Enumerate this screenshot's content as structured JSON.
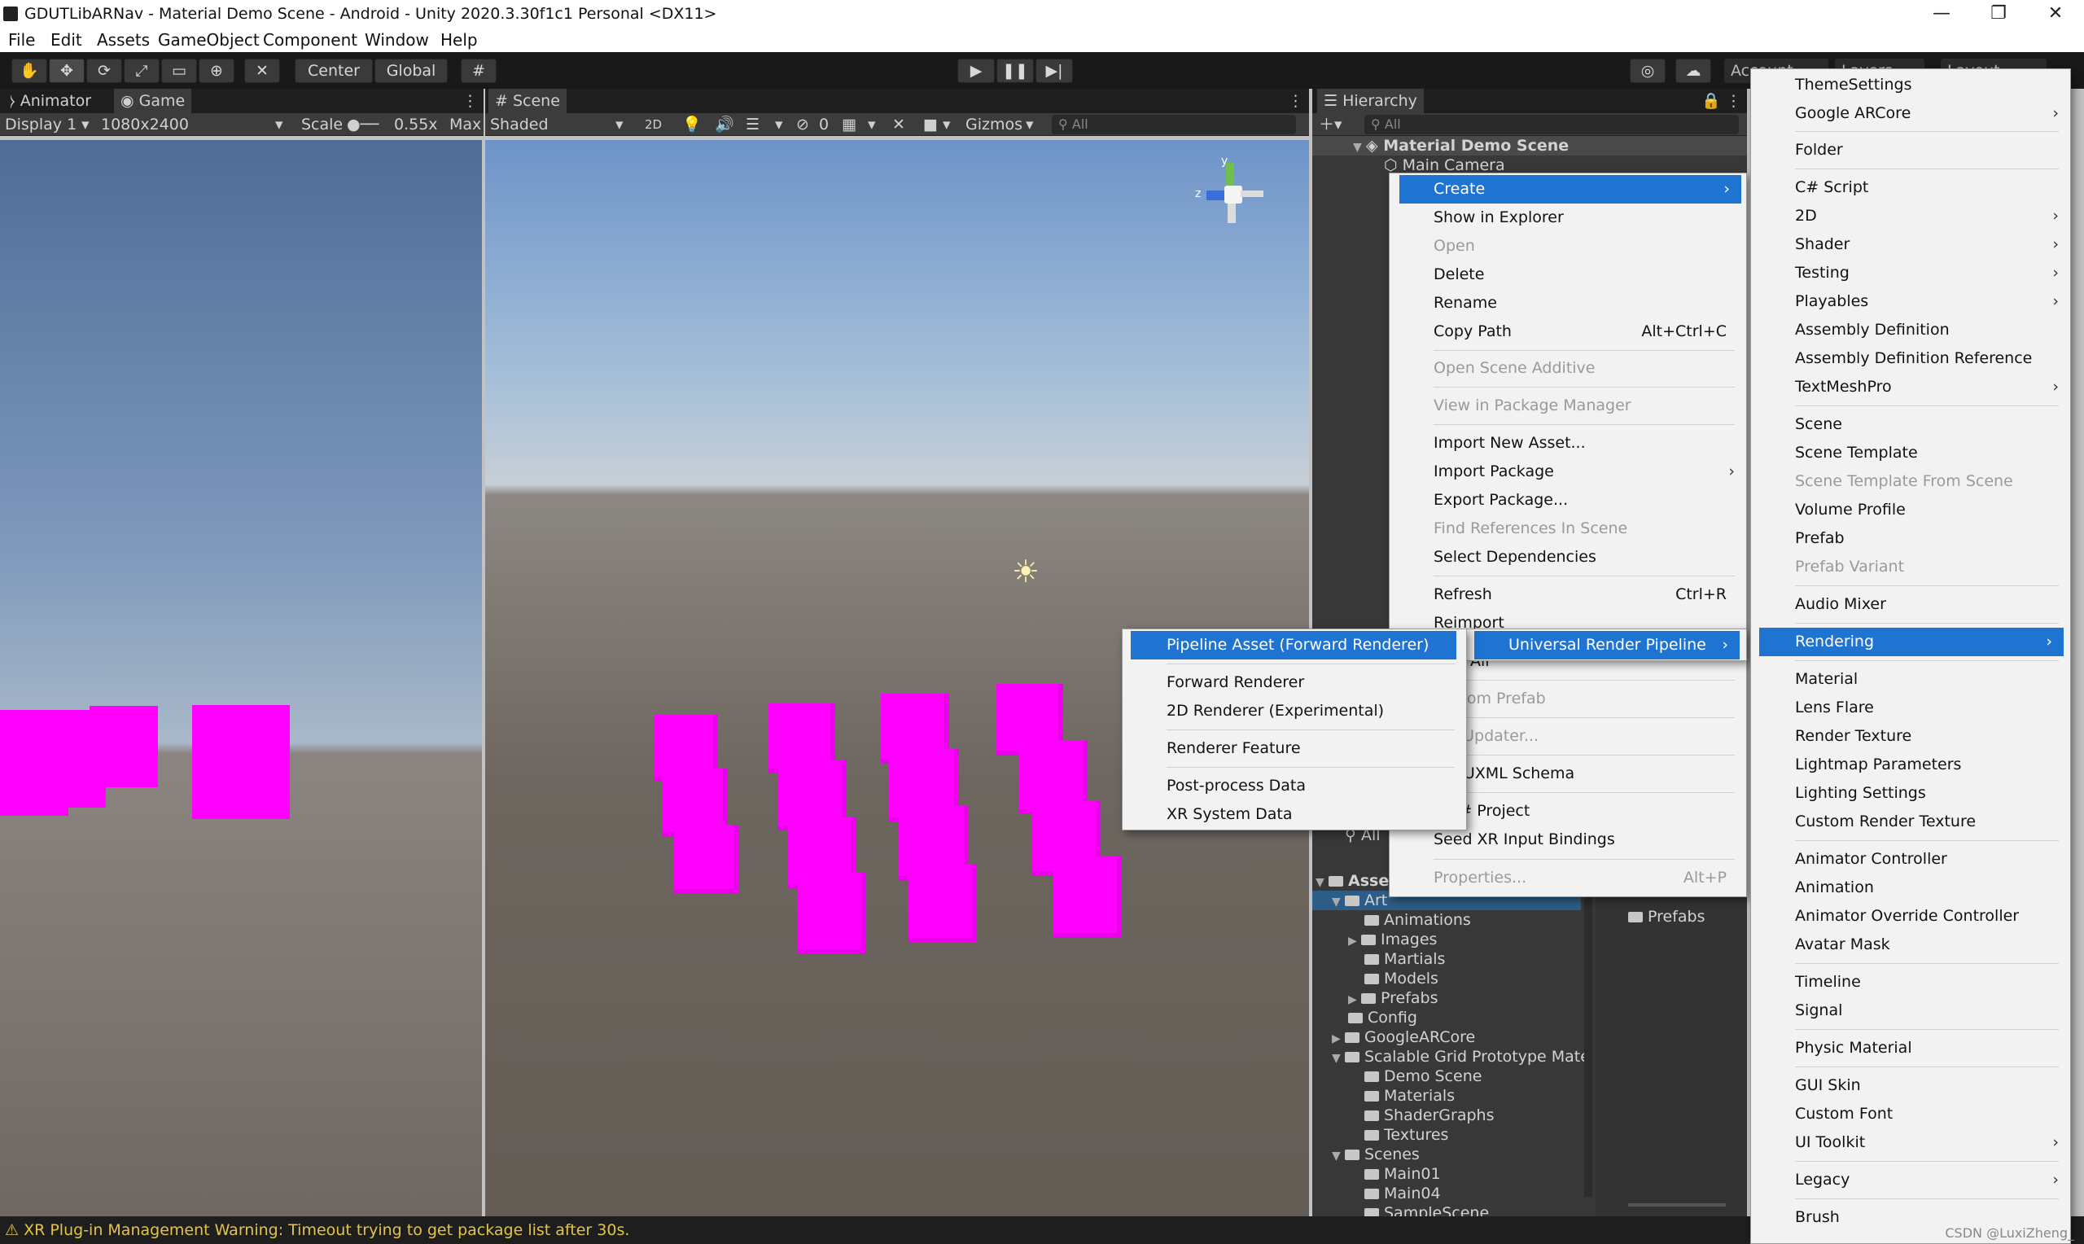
{
  "window": {
    "title": "GDUTLibARNav - Material Demo Scene - Android - Unity 2020.3.30f1c1 Personal <DX11>",
    "controls": [
      "—",
      "❐",
      "✕"
    ]
  },
  "menubar": [
    "File",
    "Edit",
    "Assets",
    "GameObject",
    "Component",
    "Window",
    "Help"
  ],
  "toolbar": {
    "pivot_label": "Center",
    "space_label": "Global",
    "account_label": "Account",
    "layers_label": "Layers",
    "layout_label": "Layout"
  },
  "game_panel": {
    "tabs": [
      "Animator",
      "Game"
    ],
    "display": "Display 1",
    "resolution": "1080x2400",
    "scale_label": "Scale",
    "scale_value": "0.55x",
    "max_label": "Max"
  },
  "scene_panel": {
    "tab": "Scene",
    "shading": "Shaded",
    "mode_2d": "2D",
    "hidden_count": "0",
    "gizmos": "Gizmos",
    "search_placeholder": "All",
    "axis_labels": {
      "y": "y",
      "z": "z"
    }
  },
  "hierarchy": {
    "tab": "Hierarchy",
    "search_placeholder": "All",
    "scene_name": "Material Demo Scene",
    "items": [
      "Main Camera"
    ]
  },
  "project": {
    "search_placeholder": "All",
    "root": "Assets",
    "tree": [
      {
        "label": "Art",
        "depth": 1,
        "selected": true
      },
      {
        "label": "Animations",
        "depth": 2
      },
      {
        "label": "Images",
        "depth": 2
      },
      {
        "label": "Martials",
        "depth": 2
      },
      {
        "label": "Models",
        "depth": 2
      },
      {
        "label": "Prefabs",
        "depth": 2
      },
      {
        "label": "Config",
        "depth": 1
      },
      {
        "label": "GoogleARCore",
        "depth": 1
      },
      {
        "label": "Scalable Grid Prototype Mate",
        "depth": 1
      },
      {
        "label": "Demo Scene",
        "depth": 2
      },
      {
        "label": "Materials",
        "depth": 2
      },
      {
        "label": "ShaderGraphs",
        "depth": 2
      },
      {
        "label": "Textures",
        "depth": 2
      },
      {
        "label": "Scenes",
        "depth": 1
      },
      {
        "label": "Main01",
        "depth": 2
      },
      {
        "label": "Main04",
        "depth": 2
      },
      {
        "label": "SampleScene",
        "depth": 2
      }
    ],
    "right_pane_folder": "Prefabs"
  },
  "context_menu": [
    {
      "label": "Create",
      "highlight": true,
      "submenu": true
    },
    {
      "label": "Show in Explorer"
    },
    {
      "label": "Open",
      "disabled": true
    },
    {
      "label": "Delete"
    },
    {
      "label": "Rename"
    },
    {
      "label": "Copy Path",
      "shortcut": "Alt+Ctrl+C"
    },
    {
      "label": "Open Scene Additive",
      "disabled": true
    },
    {
      "label": "View in Package Manager",
      "disabled": true
    },
    {
      "label": "Import New Asset..."
    },
    {
      "label": "Import Package",
      "submenu": true
    },
    {
      "label": "Export Package..."
    },
    {
      "label": "Find References In Scene",
      "disabled": true
    },
    {
      "label": "Select Dependencies"
    },
    {
      "label": "Refresh",
      "shortcut": "Ctrl+R"
    },
    {
      "label": "Reimport"
    },
    {
      "label": "port All"
    },
    {
      "label": "ct From Prefab",
      "disabled": true
    },
    {
      "label": "API Updater...",
      "disabled": true
    },
    {
      "label": "ate UXML Schema"
    },
    {
      "label": "n C# Project"
    },
    {
      "label": "Seed XR Input Bindings"
    },
    {
      "label": "Properties...",
      "shortcut": "Alt+P",
      "disabled": true
    }
  ],
  "create_submenu": [
    {
      "label": "ThemeSettings"
    },
    {
      "label": "Google ARCore",
      "submenu": true
    },
    {
      "label": "Folder"
    },
    {
      "label": "C# Script"
    },
    {
      "label": "2D",
      "submenu": true
    },
    {
      "label": "Shader",
      "submenu": true
    },
    {
      "label": "Testing",
      "submenu": true
    },
    {
      "label": "Playables",
      "submenu": true
    },
    {
      "label": "Assembly Definition"
    },
    {
      "label": "Assembly Definition Reference"
    },
    {
      "label": "TextMeshPro",
      "submenu": true
    },
    {
      "label": "Scene"
    },
    {
      "label": "Scene Template"
    },
    {
      "label": "Scene Template From Scene",
      "disabled": true
    },
    {
      "label": "Volume Profile"
    },
    {
      "label": "Prefab"
    },
    {
      "label": "Prefab Variant",
      "disabled": true
    },
    {
      "label": "Audio Mixer"
    },
    {
      "label": "Rendering",
      "highlight": true,
      "submenu": true
    },
    {
      "label": "Material"
    },
    {
      "label": "Lens Flare"
    },
    {
      "label": "Render Texture"
    },
    {
      "label": "Lightmap Parameters"
    },
    {
      "label": "Lighting Settings"
    },
    {
      "label": "Custom Render Texture"
    },
    {
      "label": "Animator Controller"
    },
    {
      "label": "Animation"
    },
    {
      "label": "Animator Override Controller"
    },
    {
      "label": "Avatar Mask"
    },
    {
      "label": "Timeline"
    },
    {
      "label": "Signal"
    },
    {
      "label": "Physic Material"
    },
    {
      "label": "GUI Skin"
    },
    {
      "label": "Custom Font"
    },
    {
      "label": "UI Toolkit",
      "submenu": true
    },
    {
      "label": "Legacy",
      "submenu": true
    },
    {
      "label": "Brush"
    }
  ],
  "rendering_submenu": [
    {
      "label": "Universal Render Pipeline",
      "highlight": true,
      "submenu": true
    }
  ],
  "urp_submenu": [
    {
      "label": "Pipeline Asset (Forward Renderer)",
      "highlight": true
    },
    {
      "label": "Forward Renderer"
    },
    {
      "label": "2D Renderer (Experimental)"
    },
    {
      "label": "Renderer Feature"
    },
    {
      "label": "Post-process Data"
    },
    {
      "label": "XR System Data"
    }
  ],
  "status": {
    "warning": "XR Plug-in Management Warning: Timeout trying to get package list after 30s."
  },
  "watermark": "CSDN @LuxiZheng_",
  "colors": {
    "highlight": "#1f74d1",
    "cube": "#ff00ff",
    "warning": "#e3c449"
  }
}
